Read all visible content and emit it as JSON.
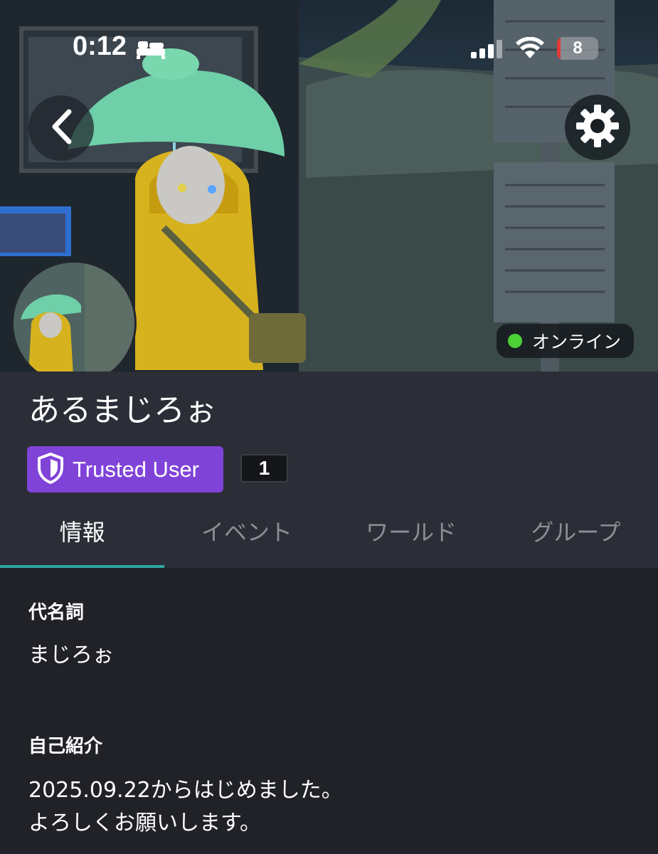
{
  "status_bar": {
    "time": "0:12",
    "battery_level": "8",
    "battery_fraction": 0.08
  },
  "banner": {
    "status_text": "オンライン",
    "status_color": "#4cd137"
  },
  "profile": {
    "display_name": "あるまじろぉ",
    "trust_rank": "Trusted User",
    "trust_color": "#8043d8",
    "badge_count": "1"
  },
  "tabs": [
    {
      "label": "情報",
      "active": true
    },
    {
      "label": "イベント",
      "active": false
    },
    {
      "label": "ワールド",
      "active": false
    },
    {
      "label": "グループ",
      "active": false
    }
  ],
  "info": {
    "pronouns_label": "代名詞",
    "pronouns_value": "まじろぉ",
    "bio_label": "自己紹介",
    "bio_lines": [
      "2025.09.22からはじめました。",
      "よろしくお願いします。"
    ]
  },
  "icons": {
    "back": "chevron-left-icon",
    "settings": "gear-icon",
    "shield": "shield-icon",
    "sleep": "bed-icon",
    "signal": "signal-icon",
    "wifi": "wifi-icon"
  },
  "accent_color": "#2fa8a0"
}
